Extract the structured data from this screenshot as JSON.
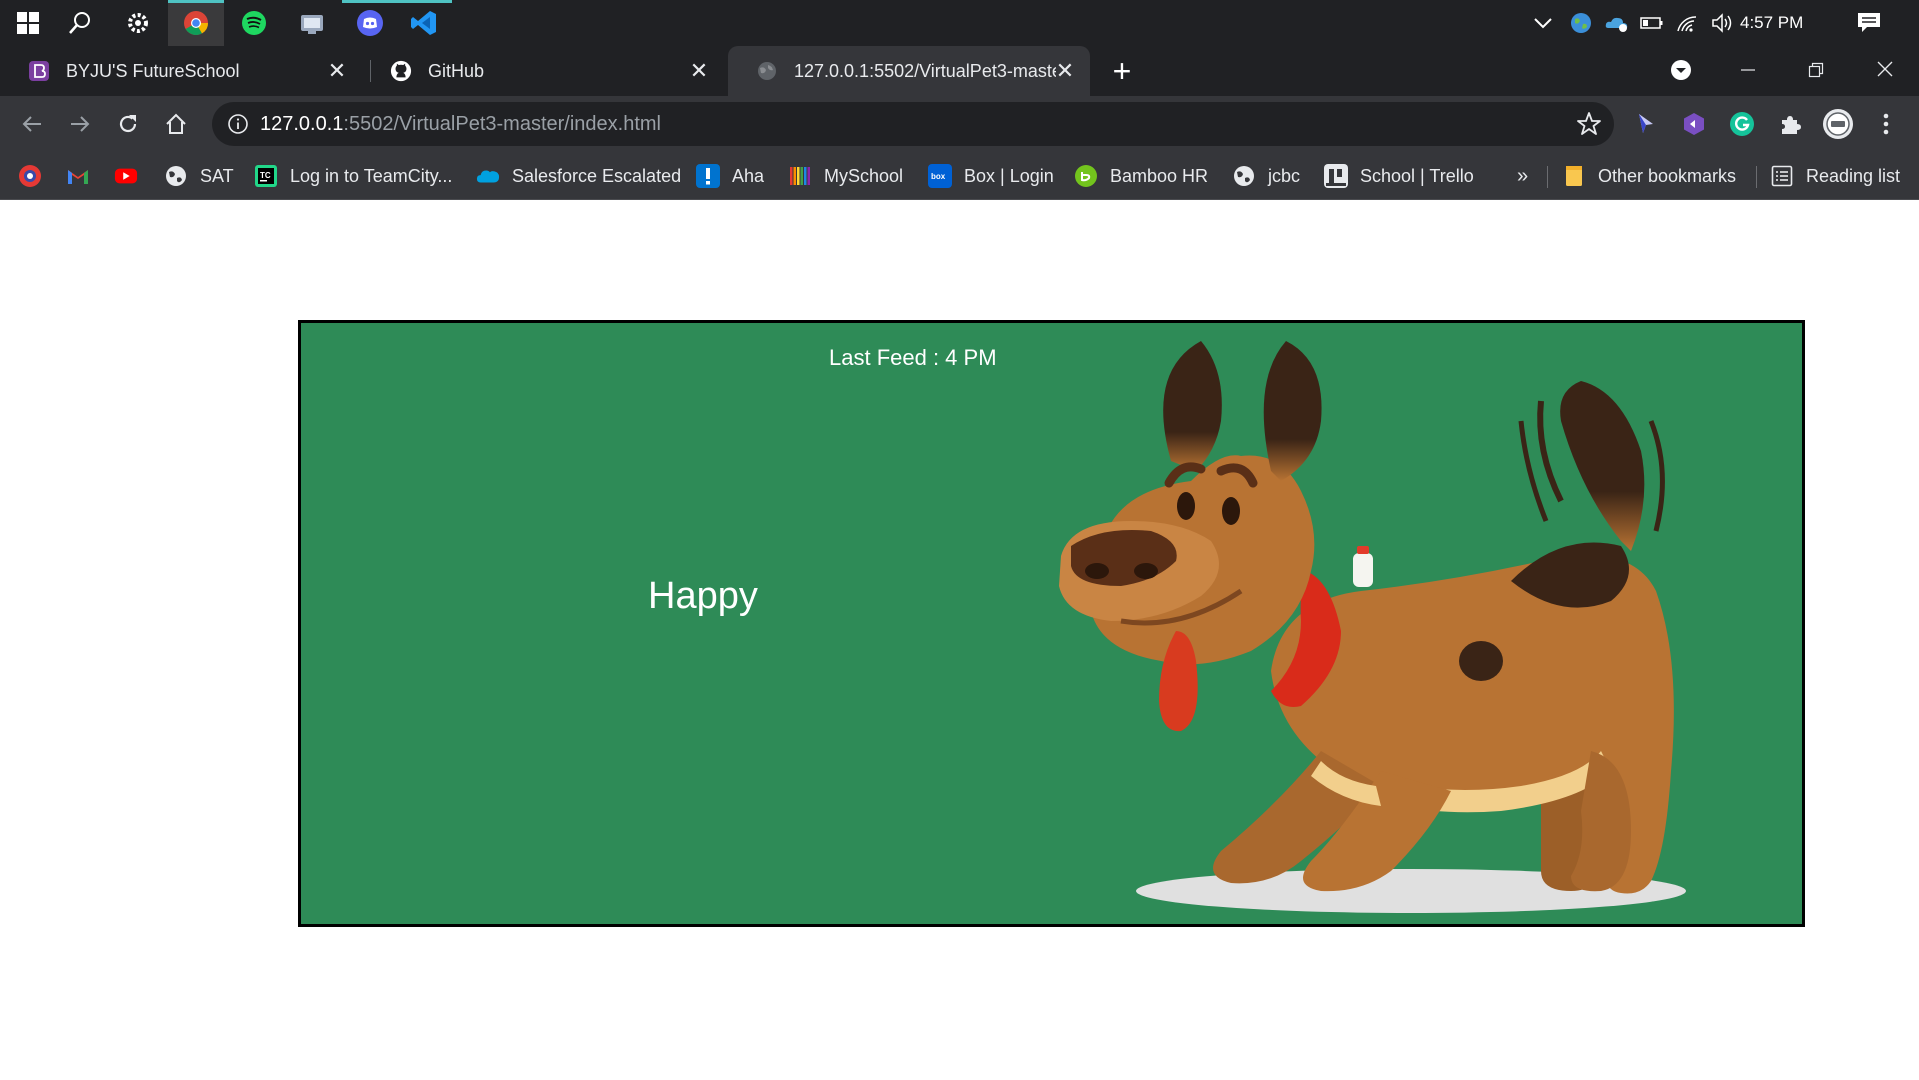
{
  "taskbar": {
    "clock": "4:57 PM",
    "apps": [
      {
        "name": "windows-start"
      },
      {
        "name": "search"
      },
      {
        "name": "settings"
      },
      {
        "name": "chrome"
      },
      {
        "name": "spotify"
      },
      {
        "name": "file-explorer"
      },
      {
        "name": "discord"
      },
      {
        "name": "vscode"
      }
    ]
  },
  "tabs": [
    {
      "title": "BYJU'S FutureSchool",
      "active": false
    },
    {
      "title": "GitHub",
      "active": false
    },
    {
      "title": "127.0.0.1:5502/VirtualPet3-maste",
      "active": true
    }
  ],
  "toolbar": {
    "url_host": "127.0.0.1",
    "url_path": ":5502/VirtualPet3-master/index.html"
  },
  "bookmarks": {
    "items": [
      {
        "label": "",
        "icon": "red-app-icon"
      },
      {
        "label": "",
        "icon": "gmail-icon"
      },
      {
        "label": "",
        "icon": "youtube-icon"
      },
      {
        "label": "SAT",
        "icon": "globe-icon"
      },
      {
        "label": "Log in to TeamCity...",
        "icon": "teamcity-icon"
      },
      {
        "label": "Salesforce Escalated",
        "icon": "salesforce-icon"
      },
      {
        "label": "Aha",
        "icon": "aha-icon"
      },
      {
        "label": "MySchool",
        "icon": "myschool-icon"
      },
      {
        "label": "Box | Login",
        "icon": "box-icon"
      },
      {
        "label": "Bamboo HR",
        "icon": "bamboo-icon"
      },
      {
        "label": "jcbc",
        "icon": "globe-icon"
      },
      {
        "label": "School | Trello",
        "icon": "trello-icon"
      }
    ],
    "overflow": "»",
    "other_bookmarks": "Other bookmarks",
    "reading_list": "Reading list"
  },
  "game": {
    "last_feed": "Last Feed : 4 PM",
    "mood": "Happy",
    "background_color": "#2e8b57"
  },
  "colors": {
    "taskbar": "#202124",
    "toolbar": "#35363a",
    "dog_body": "#b87333",
    "collar": "#d92b1a"
  }
}
